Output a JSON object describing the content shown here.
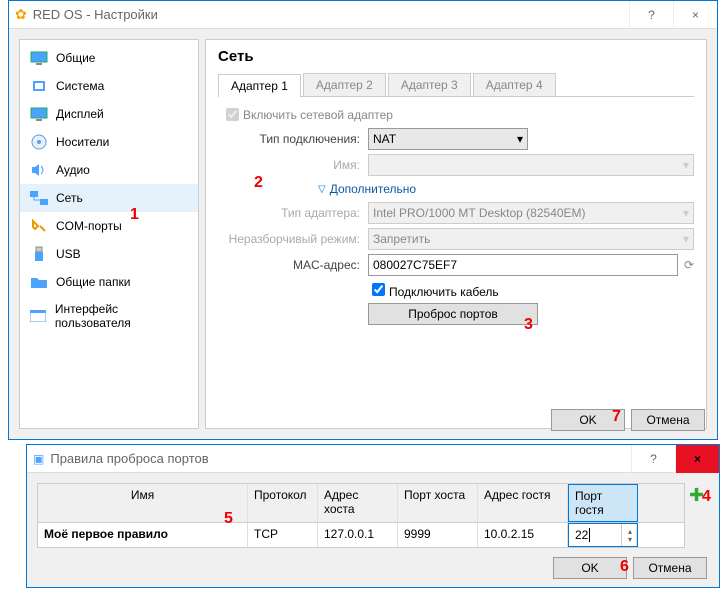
{
  "main": {
    "title": "RED OS - Настройки",
    "help": "?",
    "close": "×",
    "sidebar": [
      {
        "label": "Общие"
      },
      {
        "label": "Система"
      },
      {
        "label": "Дисплей"
      },
      {
        "label": "Носители"
      },
      {
        "label": "Аудио"
      },
      {
        "label": "Сеть"
      },
      {
        "label": "COM-порты"
      },
      {
        "label": "USB"
      },
      {
        "label": "Общие папки"
      },
      {
        "label": "Интерфейс пользователя"
      }
    ],
    "heading": "Сеть",
    "tabs": [
      "Адаптер 1",
      "Адаптер 2",
      "Адаптер 3",
      "Адаптер 4"
    ],
    "enable_label": "Включить сетевой адаптер",
    "conn_label": "Тип подключения:",
    "conn_value": "NAT",
    "name_label": "Имя:",
    "advanced": "Дополнительно",
    "adapter_type_label": "Тип адаптера:",
    "adapter_type_value": "Intel PRO/1000 MT Desktop (82540EM)",
    "promisc_label": "Неразборчивый режим:",
    "promisc_value": "Запретить",
    "mac_label": "MAC-адрес:",
    "mac_value": "080027C75EF7",
    "cable_label": "Подключить кабель",
    "port_fwd_btn": "Проброс портов",
    "ok": "OK",
    "cancel": "Отмена"
  },
  "port": {
    "title": "Правила проброса портов",
    "help": "?",
    "close": "×",
    "cols": {
      "name": "Имя",
      "proto": "Протокол",
      "hadr": "Адрес хоста",
      "hport": "Порт хоста",
      "gadr": "Адрес гостя",
      "gport": "Порт гостя"
    },
    "row": {
      "name": "Моё первое правило",
      "proto": "TCP",
      "hadr": "127.0.0.1",
      "hport": "9999",
      "gadr": "10.0.2.15",
      "gport": "22"
    },
    "ok": "OK",
    "cancel": "Отмена"
  },
  "annot": {
    "a1": "1",
    "a2": "2",
    "a3": "3",
    "a4": "4",
    "a5": "5",
    "a6": "6",
    "a7": "7"
  }
}
